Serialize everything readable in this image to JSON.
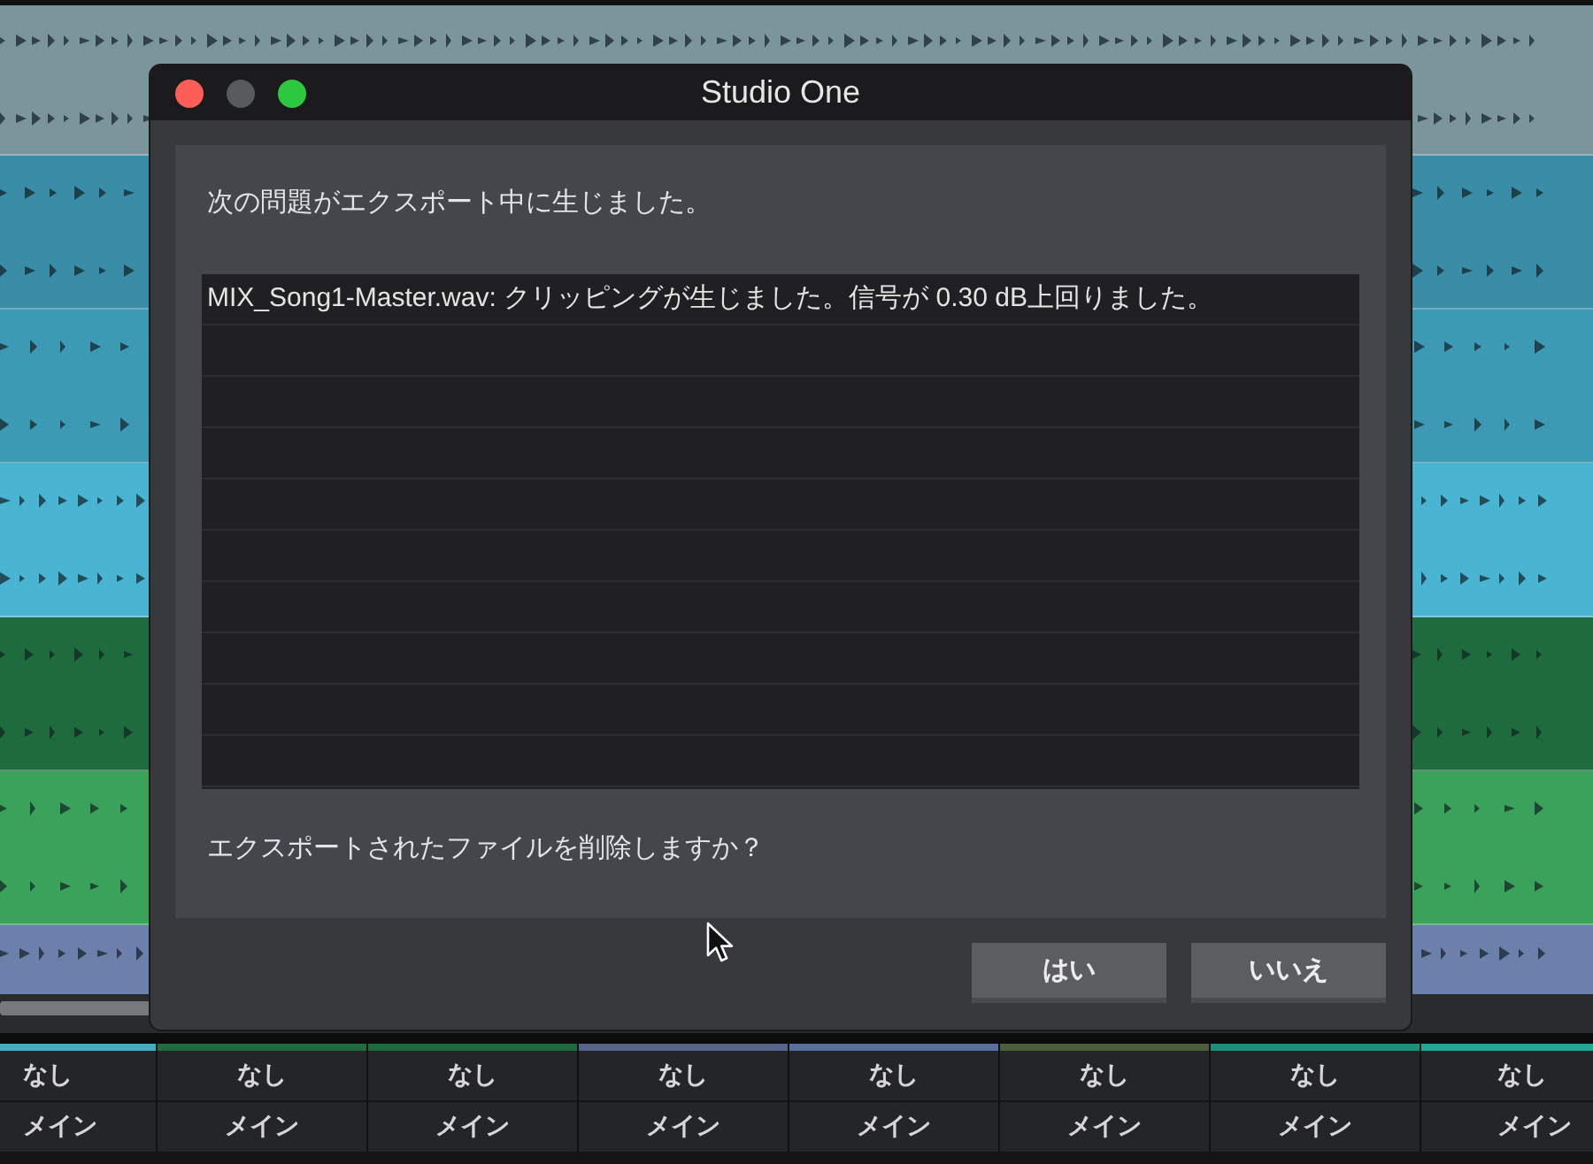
{
  "arrangement": {
    "tracks": [
      {
        "color": "#7a959b"
      },
      {
        "color": "#3a8da6"
      },
      {
        "color": "#3d9ab5"
      },
      {
        "color": "#4ab5d3"
      },
      {
        "color": "#1e6b3d"
      },
      {
        "color": "#3aa25b"
      },
      {
        "color": "#6b80aa"
      }
    ]
  },
  "dialog": {
    "title": "Studio One",
    "window_controls": [
      {
        "kind": "close",
        "disabled": false
      },
      {
        "kind": "minimize",
        "disabled": true
      },
      {
        "kind": "zoom",
        "disabled": false
      }
    ],
    "message": "次の問題がエクスポート中に生じました。",
    "issues": [
      "MIX_Song1-Master.wav: クリッピングが生じました。信号が 0.30 dB上回りました。"
    ],
    "question": "エクスポートされたファイルを削除しますか？",
    "buttons": [
      {
        "label": "はい"
      },
      {
        "label": "いいえ"
      }
    ]
  },
  "mixer": {
    "channels": [
      {
        "color": "#48a9c4",
        "input": "なし",
        "output": "メイン"
      },
      {
        "color": "#1f6c40",
        "input": "なし",
        "output": "メイン"
      },
      {
        "color": "#1d6a3e",
        "input": "なし",
        "output": "メイン"
      },
      {
        "color": "#56648a",
        "input": "なし",
        "output": "メイン"
      },
      {
        "color": "#5a6fa0",
        "input": "なし",
        "output": "メイン"
      },
      {
        "color": "#4b5e3c",
        "input": "なし",
        "output": "メイン"
      },
      {
        "color": "#1f8e7a",
        "input": "なし",
        "output": "メイン"
      },
      {
        "color": "#25a595",
        "input": "なし",
        "output": "メイン"
      }
    ]
  }
}
